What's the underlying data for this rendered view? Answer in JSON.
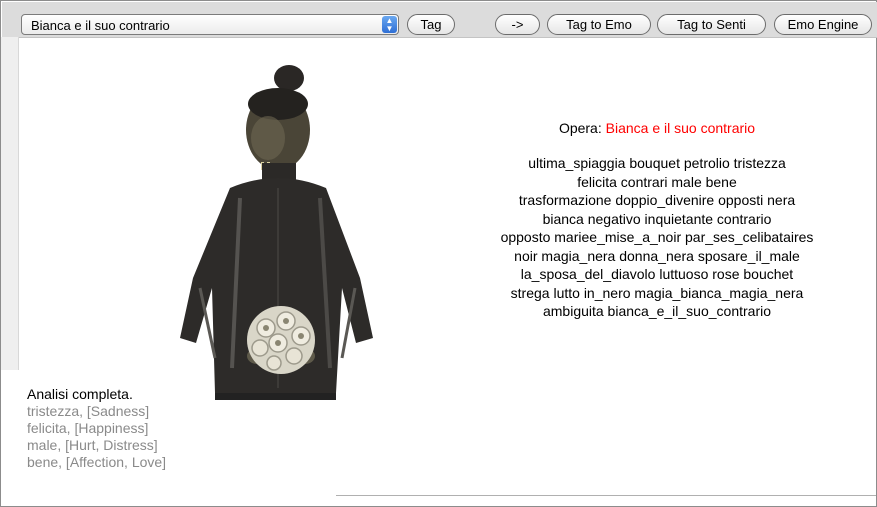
{
  "toolbar": {
    "selected_opera": "Bianca e il suo contrario",
    "buttons": {
      "tag": "Tag",
      "arrow": "->",
      "tag_to_emo": "Tag to Emo",
      "tag_to_senti": "Tag to Senti",
      "emo_engine": "Emo Engine"
    }
  },
  "main": {
    "opera_label": "Opera:",
    "opera_title": "Bianca e il suo contrario",
    "opera_title_color": "#ff0000",
    "tag_lines": [
      "ultima_spiaggia bouquet petrolio tristezza",
      "felicita contrari male bene",
      "trasformazione doppio_divenire opposti nera",
      "bianca negativo inquietante contrario",
      "opposto mariee_mise_a_noir par_ses_celibataires",
      "noir magia_nera donna_nera sposare_il_male",
      "la_sposa_del_diavolo luttuoso rose bouchet",
      "strega lutto in_nero magia_bianca_magia_nera",
      "ambiguita bianca_e_il_suo_contrario"
    ]
  },
  "analysis": {
    "status": "Analisi completa.",
    "results": [
      "tristezza, [Sadness]",
      "felicita, [Happiness]",
      "male, [Hurt, Distress]",
      "bene, [Affection, Love]"
    ],
    "result_color": "#8a8a8a"
  }
}
